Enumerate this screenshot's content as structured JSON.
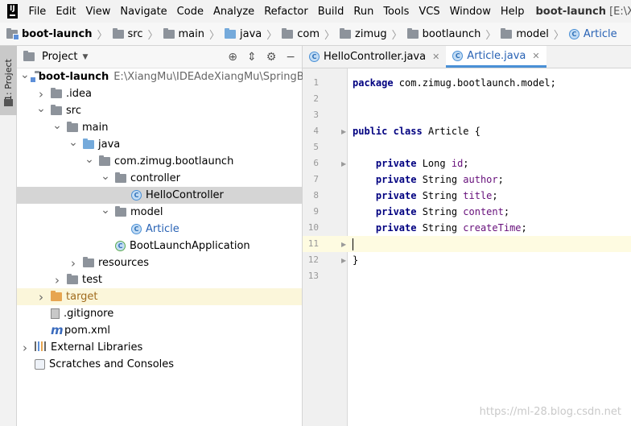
{
  "menubar": {
    "items": [
      "File",
      "Edit",
      "View",
      "Navigate",
      "Code",
      "Analyze",
      "Refactor",
      "Build",
      "Run",
      "Tools",
      "VCS",
      "Window",
      "Help"
    ],
    "project_name": "boot-launch",
    "project_path": "[E:\\XiangMu"
  },
  "breadcrumb": [
    "boot-launch",
    "src",
    "main",
    "java",
    "com",
    "zimug",
    "bootlaunch",
    "model",
    "Article"
  ],
  "side_tab": {
    "label": "1: Project"
  },
  "project_panel": {
    "title": "Project",
    "tree": [
      {
        "label": "boot-launch",
        "extra": "E:\\XiangMu\\IDEAdeXiangMu\\SpringBoot",
        "indent": 0,
        "arrow": "open",
        "icon": "module-folder",
        "style": "bold"
      },
      {
        "label": ".idea",
        "indent": 1,
        "arrow": "closed",
        "icon": "folder"
      },
      {
        "label": "src",
        "indent": 1,
        "arrow": "open",
        "icon": "folder"
      },
      {
        "label": "main",
        "indent": 2,
        "arrow": "open",
        "icon": "folder"
      },
      {
        "label": "java",
        "indent": 3,
        "arrow": "open",
        "icon": "blue-folder"
      },
      {
        "label": "com.zimug.bootlaunch",
        "indent": 4,
        "arrow": "open",
        "icon": "folder"
      },
      {
        "label": "controller",
        "indent": 5,
        "arrow": "open",
        "icon": "folder"
      },
      {
        "label": "HelloController",
        "indent": 6,
        "arrow": "none",
        "icon": "class",
        "state": "selected"
      },
      {
        "label": "model",
        "indent": 5,
        "arrow": "open",
        "icon": "folder"
      },
      {
        "label": "Article",
        "indent": 6,
        "arrow": "none",
        "icon": "class",
        "style": "blue"
      },
      {
        "label": "BootLaunchApplication",
        "indent": 5,
        "arrow": "none",
        "icon": "spring-class"
      },
      {
        "label": "resources",
        "indent": 3,
        "arrow": "closed",
        "icon": "folder"
      },
      {
        "label": "test",
        "indent": 2,
        "arrow": "closed",
        "icon": "folder"
      },
      {
        "label": "target",
        "indent": 1,
        "arrow": "closed",
        "icon": "orange-folder",
        "state": "excluded",
        "style": "orange"
      },
      {
        "label": ".gitignore",
        "indent": 1,
        "arrow": "none",
        "icon": "gitignore"
      },
      {
        "label": "pom.xml",
        "indent": 1,
        "arrow": "none",
        "icon": "maven"
      },
      {
        "label": "External Libraries",
        "indent": 0,
        "arrow": "closed",
        "icon": "libraries"
      },
      {
        "label": "Scratches and Consoles",
        "indent": 0,
        "arrow": "none",
        "icon": "scratches"
      }
    ]
  },
  "editor": {
    "tabs": [
      {
        "label": "HelloController.java",
        "active": false
      },
      {
        "label": "Article.java",
        "active": true
      }
    ],
    "current_line": 11,
    "lines": [
      [
        {
          "t": "package",
          "c": "kw"
        },
        {
          "t": " com.zimug.bootlaunch.model;",
          "c": ""
        }
      ],
      [],
      [],
      [
        {
          "t": "public",
          "c": "kw"
        },
        {
          "t": " ",
          "c": ""
        },
        {
          "t": "class",
          "c": "kw"
        },
        {
          "t": " Article {",
          "c": ""
        }
      ],
      [],
      [
        {
          "t": "    ",
          "c": ""
        },
        {
          "t": "private",
          "c": "kw"
        },
        {
          "t": " Long ",
          "c": ""
        },
        {
          "t": "id",
          "c": "field"
        },
        {
          "t": ";",
          "c": ""
        }
      ],
      [
        {
          "t": "    ",
          "c": ""
        },
        {
          "t": "private",
          "c": "kw"
        },
        {
          "t": " String ",
          "c": ""
        },
        {
          "t": "author",
          "c": "field"
        },
        {
          "t": ";",
          "c": ""
        }
      ],
      [
        {
          "t": "    ",
          "c": ""
        },
        {
          "t": "private",
          "c": "kw"
        },
        {
          "t": " String ",
          "c": ""
        },
        {
          "t": "title",
          "c": "field"
        },
        {
          "t": ";",
          "c": ""
        }
      ],
      [
        {
          "t": "    ",
          "c": ""
        },
        {
          "t": "private",
          "c": "kw"
        },
        {
          "t": " String ",
          "c": ""
        },
        {
          "t": "content",
          "c": "field"
        },
        {
          "t": ";",
          "c": ""
        }
      ],
      [
        {
          "t": "    ",
          "c": ""
        },
        {
          "t": "private",
          "c": "kw"
        },
        {
          "t": " String ",
          "c": ""
        },
        {
          "t": "createTime",
          "c": "field"
        },
        {
          "t": ";",
          "c": ""
        }
      ],
      [],
      [
        {
          "t": "}",
          "c": ""
        }
      ],
      []
    ],
    "fold_lines": [
      4,
      6,
      11,
      12
    ]
  },
  "watermark": "https://ml-28.blog.csdn.net",
  "colors": {
    "keyword": "#000080",
    "field": "#660e7a",
    "selection": "#d5d5d5",
    "current_line": "#fefbe1",
    "accent": "#4a90d6"
  }
}
